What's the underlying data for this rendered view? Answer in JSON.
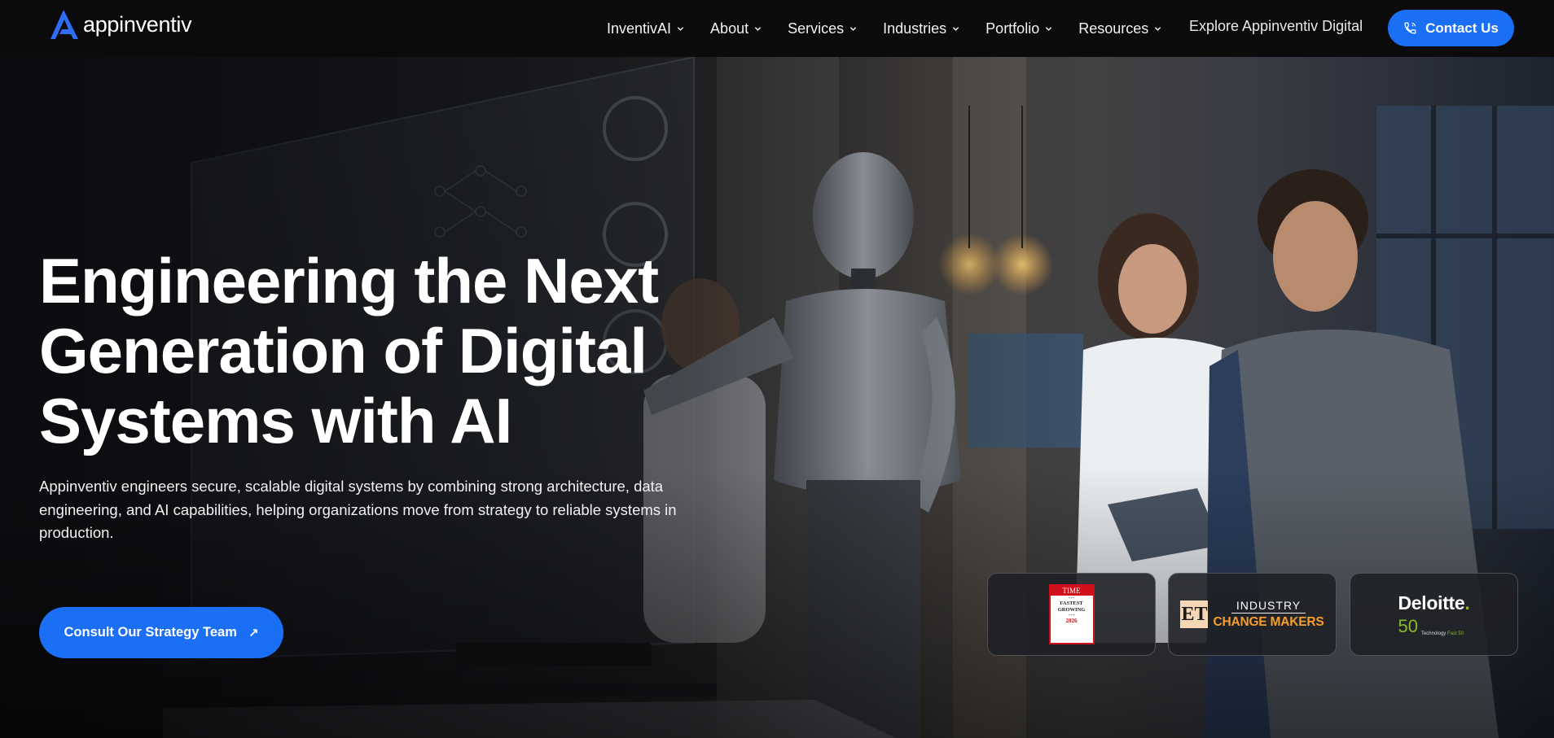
{
  "header": {
    "brand": "appinventiv",
    "nav": [
      {
        "label": "InventivAI"
      },
      {
        "label": "About"
      },
      {
        "label": "Services"
      },
      {
        "label": "Industries"
      },
      {
        "label": "Portfolio"
      },
      {
        "label": "Resources"
      }
    ],
    "explore_label": "Explore Appinventiv Digital",
    "contact_label": "Contact Us"
  },
  "hero": {
    "title_lines": [
      "Engineering the Next",
      "Generation of Digital",
      "Systems with AI"
    ],
    "description": "Appinventiv engineers secure, scalable digital systems by combining strong architecture, data engineering, and AI capabilities, helping organizations move from strategy to reliable systems in production.",
    "cta_label": "Consult Our Strategy Team",
    "cta_arrow": "↗"
  },
  "awards": {
    "time": {
      "masthead": "TIME",
      "line1": "FASTEST",
      "line2": "GROWING",
      "year": "2026"
    },
    "et": {
      "badge": "ET",
      "line1": "INDUSTRY",
      "line2": "CHANGE MAKERS"
    },
    "deloitte": {
      "name": "Deloitte",
      "dot": ".",
      "number": "50",
      "sub_prefix": "Technology",
      "sub_accent": "Fast 50"
    }
  },
  "colors": {
    "accent": "#1a6ff5",
    "header_bg": "#0b0b0c",
    "deloitte_green": "#86bc25",
    "et_orange": "#f59e2b"
  },
  "icons": {
    "logo": "appinventiv-logo-icon",
    "nav_chevron": "chevron-down-icon",
    "contact": "phone-icon",
    "cta": "arrow-up-right-icon"
  }
}
